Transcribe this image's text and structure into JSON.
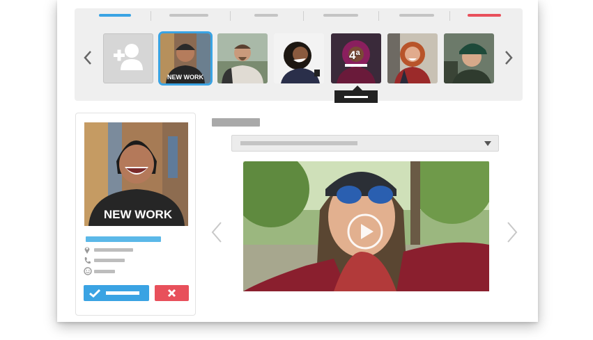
{
  "thumbnails": {
    "badge_text": "4ª",
    "selected_index": 1
  },
  "profile": {
    "shirt_text": "NEW WORK"
  },
  "colors": {
    "accent_blue": "#3aa3e3",
    "accent_red": "#e8505b",
    "placeholder_gray": "#bdbdbd"
  },
  "icons": [
    "chevron-left-icon",
    "chevron-right-icon",
    "add-user-icon",
    "location-pin-icon",
    "phone-icon",
    "smiley-icon",
    "checkmark-icon",
    "close-x-icon",
    "play-icon"
  ]
}
